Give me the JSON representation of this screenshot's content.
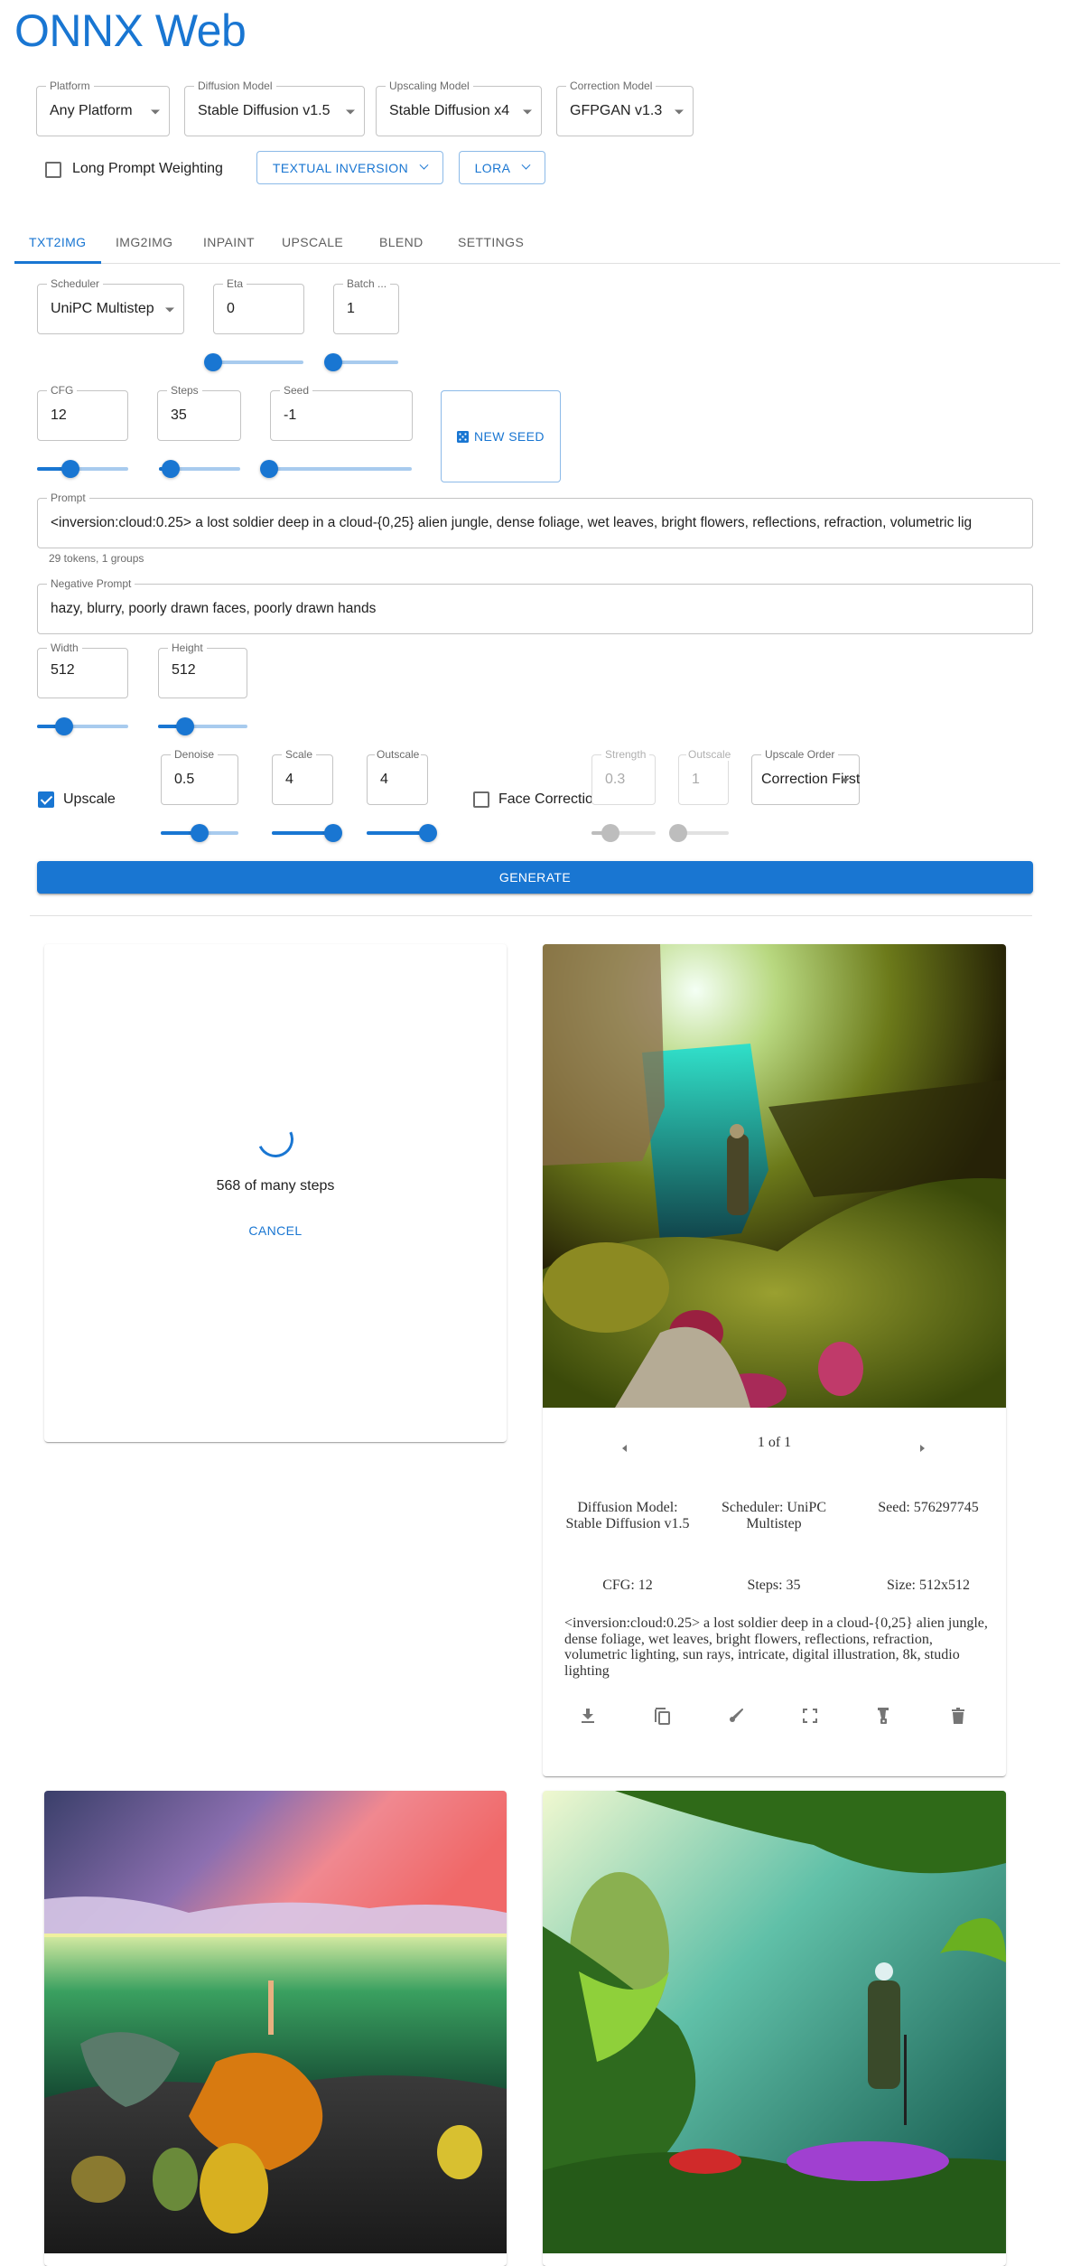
{
  "app": {
    "title": "ONNX Web"
  },
  "models": {
    "platform": {
      "label": "Platform",
      "value": "Any Platform"
    },
    "diffusion": {
      "label": "Diffusion Model",
      "value": "Stable Diffusion v1.5"
    },
    "upscaling": {
      "label": "Upscaling Model",
      "value": "Stable Diffusion x4"
    },
    "correction": {
      "label": "Correction Model",
      "value": "GFPGAN v1.3"
    },
    "long_prompt_weighting": {
      "label": "Long Prompt Weighting",
      "checked": false
    },
    "textual_inversion_button": "TEXTUAL INVERSION",
    "lora_button": "LORA"
  },
  "tabs": [
    {
      "label": "TXT2IMG",
      "active": true
    },
    {
      "label": "IMG2IMG",
      "active": false
    },
    {
      "label": "INPAINT",
      "active": false
    },
    {
      "label": "UPSCALE",
      "active": false
    },
    {
      "label": "BLEND",
      "active": false
    },
    {
      "label": "SETTINGS",
      "active": false
    }
  ],
  "params": {
    "scheduler": {
      "label": "Scheduler",
      "value": "UniPC Multistep"
    },
    "eta": {
      "label": "Eta",
      "value": "0",
      "slider_fraction": 0.0
    },
    "batch": {
      "label": "Batch ...",
      "value": "1",
      "slider_fraction": 0.0
    },
    "cfg": {
      "label": "CFG",
      "value": "12",
      "slider_fraction": 0.37
    },
    "steps": {
      "label": "Steps",
      "value": "35",
      "slider_fraction": 0.14
    },
    "seed": {
      "label": "Seed",
      "value": "-1",
      "slider_fraction": 0.0
    },
    "new_seed_button": "NEW SEED",
    "prompt": {
      "label": "Prompt",
      "value": "<inversion:cloud:0.25> a lost soldier deep in a cloud-{0,25} alien jungle, dense foliage, wet leaves, bright flowers, reflections, refraction, volumetric lig",
      "helper": "29 tokens, 1 groups"
    },
    "negative_prompt": {
      "label": "Negative Prompt",
      "value": "hazy, blurry, poorly drawn faces, poorly drawn hands"
    },
    "width": {
      "label": "Width",
      "value": "512",
      "slider_fraction": 0.3
    },
    "height": {
      "label": "Height",
      "value": "512",
      "slider_fraction": 0.3
    }
  },
  "upscale": {
    "checkbox": {
      "label": "Upscale",
      "checked": true
    },
    "denoise": {
      "label": "Denoise",
      "value": "0.5",
      "slider_fraction": 0.5
    },
    "scale": {
      "label": "Scale",
      "value": "4",
      "slider_fraction": 1.0
    },
    "outscale": {
      "label": "Outscale",
      "value": "4",
      "slider_fraction": 1.0
    },
    "face_correction": {
      "label": "Face Correction",
      "checked": false
    },
    "strength": {
      "label": "Strength",
      "value": "0.3",
      "slider_fraction": 0.3
    },
    "correction_outscale": {
      "label": "Outscale",
      "value": "1",
      "slider_fraction": 0.0
    },
    "order": {
      "label": "Upscale Order",
      "value": "Correction First"
    }
  },
  "generate_button": "GENERATE",
  "loading_card": {
    "progress_text": "568 of many steps",
    "cancel_button": "CANCEL"
  },
  "image_card": {
    "pager": "1 of 1",
    "meta": {
      "model": "Diffusion Model: Stable Diffusion v1.5",
      "scheduler": "Scheduler: UniPC Multistep",
      "seed": "Seed: 576297745",
      "cfg": "CFG: 12",
      "steps": "Steps: 35",
      "size": "Size: 512x512"
    },
    "prompt": "<inversion:cloud:0.25> a lost soldier deep in a cloud-{0,25} alien jungle, dense foliage, wet leaves, bright flowers, reflections, refraction, volumetric lighting, sun rays, intricate, digital illustration, 8k, studio lighting",
    "actions": [
      "download-icon",
      "copy-icon",
      "brush-icon",
      "fullscreen-icon",
      "blender-icon",
      "delete-icon"
    ]
  },
  "colors": {
    "primary": "#1976d2",
    "text": "#212121",
    "muted": "#6b6b6b"
  }
}
